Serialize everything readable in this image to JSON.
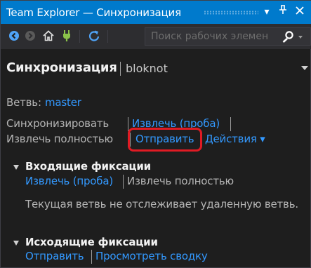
{
  "window": {
    "title": "Team Explorer — Синхронизация",
    "dropdown_glyph": "▾",
    "pin_glyph": "⊥",
    "close_glyph": "✕"
  },
  "toolbar": {
    "back_icon": "back-arrow-icon",
    "forward_icon": "forward-arrow-icon",
    "home_icon": "home-icon",
    "connect_icon": "plug-icon",
    "refresh_icon": "refresh-icon",
    "search": {
      "placeholder": "Поиск рабочих элемен",
      "search_icon": "search-icon"
    }
  },
  "header": {
    "title": "Синхронизация",
    "context": "bloknot"
  },
  "branch": {
    "label": "Ветвь:",
    "value": "master"
  },
  "actions": {
    "sync": "Синхронизировать",
    "fetch": "Извлечь (проба)",
    "pull": "Извлечь полностью",
    "push": "Отправить",
    "more": "Действия",
    "more_glyph": "▾"
  },
  "incoming": {
    "title": "Входящие фиксации",
    "fetch": "Извлечь (проба)",
    "pull": "Извлечь полностью",
    "message": "Текущая ветвь не отслеживает удаленную ветвь."
  },
  "outgoing": {
    "title": "Исходящие фиксации",
    "push": "Отправить",
    "view_summary": "Просмотреть сводку"
  },
  "colors": {
    "accent": "#007acc",
    "link": "#3399ff",
    "highlight": "#e01b24",
    "background": "#1e1e1e"
  }
}
